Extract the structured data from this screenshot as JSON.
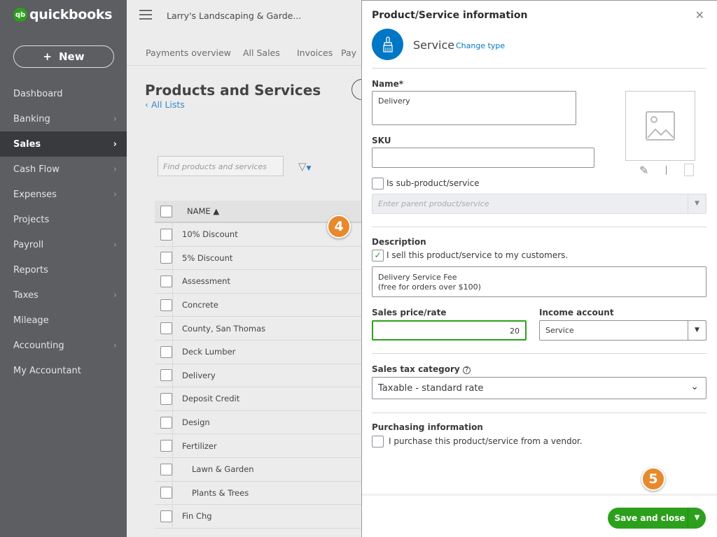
{
  "brand": {
    "logo_small": "intuit",
    "logo": "quickbooks",
    "accent": "#2ca01c"
  },
  "sidebar": {
    "new_label": "New",
    "items": [
      {
        "label": "Dashboard",
        "chevron": false
      },
      {
        "label": "Banking",
        "chevron": true
      },
      {
        "label": "Sales",
        "chevron": true,
        "active": true
      },
      {
        "label": "Cash Flow",
        "chevron": true
      },
      {
        "label": "Expenses",
        "chevron": true
      },
      {
        "label": "Projects",
        "chevron": false
      },
      {
        "label": "Payroll",
        "chevron": true
      },
      {
        "label": "Reports",
        "chevron": false
      },
      {
        "label": "Taxes",
        "chevron": true
      },
      {
        "label": "Mileage",
        "chevron": false
      },
      {
        "label": "Accounting",
        "chevron": true
      },
      {
        "label": "My Accountant",
        "chevron": false
      }
    ]
  },
  "header": {
    "company": "Larry's Landscaping & Garde..."
  },
  "subtabs": [
    "Payments overview",
    "All Sales",
    "Invoices",
    "Pay"
  ],
  "page": {
    "title": "Products and Services",
    "back_link": "All Lists",
    "search_placeholder": "Find products and services"
  },
  "table": {
    "column": "NAME ▲",
    "rows": [
      {
        "name": "10% Discount"
      },
      {
        "name": "5% Discount"
      },
      {
        "name": "Assessment"
      },
      {
        "name": "Concrete"
      },
      {
        "name": "County, San Thomas"
      },
      {
        "name": "Deck Lumber"
      },
      {
        "name": "Delivery"
      },
      {
        "name": "Deposit Credit"
      },
      {
        "name": "Design"
      },
      {
        "name": "Fertilizer"
      },
      {
        "name": "Lawn & Garden",
        "sub": true
      },
      {
        "name": "Plants & Trees",
        "sub": true
      },
      {
        "name": "Fin Chg"
      }
    ]
  },
  "panel": {
    "title": "Product/Service information",
    "type": "Service",
    "change_type": "Change type",
    "name_label": "Name*",
    "name_value": "Delivery",
    "sku_label": "SKU",
    "sku_value": "",
    "sub_label": "Is sub-product/service",
    "parent_placeholder": "Enter parent product/service",
    "description_label": "Description",
    "sell_label": "I sell this product/service to my customers.",
    "sell_checked": true,
    "description_line1": "Delivery Service Fee",
    "description_line2": "(free for orders over $100)",
    "price_label": "Sales price/rate",
    "price_value": "20",
    "income_label": "Income account",
    "income_value": "Service",
    "tax_label": "Sales tax category",
    "tax_value": "Taxable - standard rate",
    "purchasing_label": "Purchasing information",
    "purchase_label": "I purchase this product/service from a vendor.",
    "purchase_checked": false,
    "save_label": "Save and close"
  },
  "callouts": {
    "step4": "4",
    "step5": "5"
  }
}
